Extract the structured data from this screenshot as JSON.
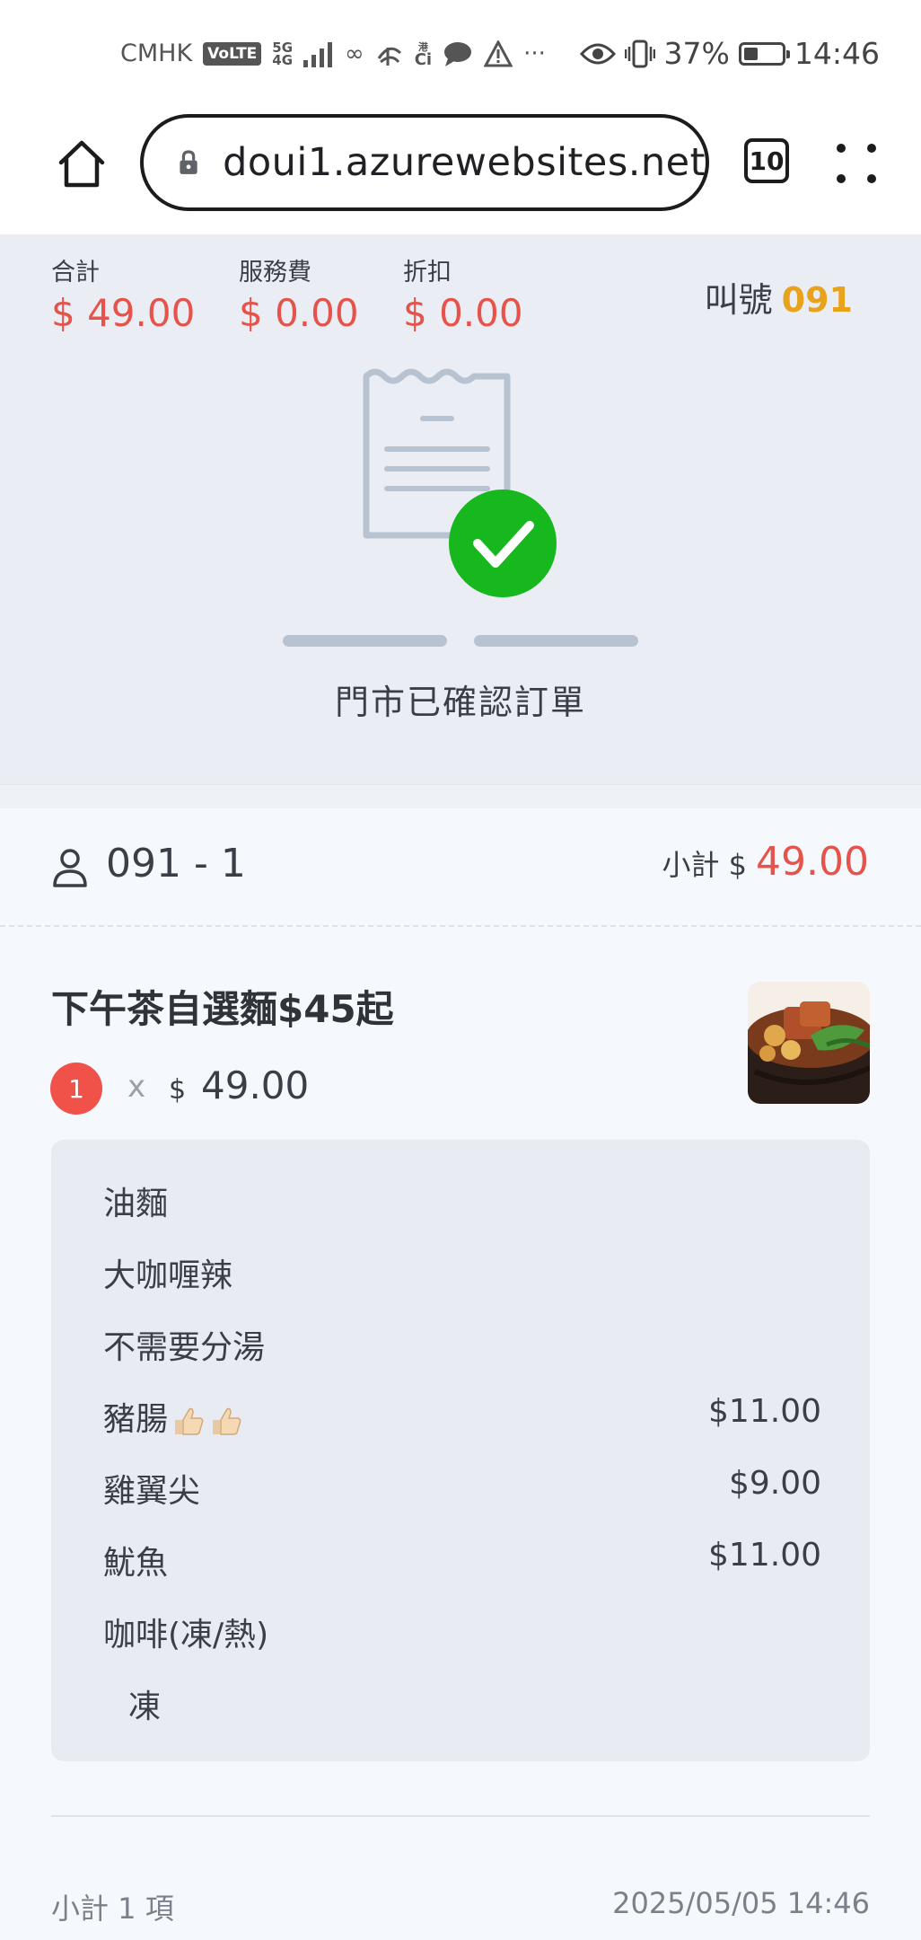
{
  "status_bar": {
    "carrier": "CMHK",
    "volte": "VoLTE",
    "network_top": "5G",
    "network_bottom": "4G",
    "battery_percent": "37%",
    "battery_level": 0.37,
    "time": "14:46",
    "icons": [
      "signal-icon",
      "infinity-icon",
      "rthk-icon",
      "ci-icon",
      "chat-bubble-icon",
      "warning-icon",
      "more-icon",
      "eye-icon",
      "vibrate-icon",
      "battery-icon"
    ]
  },
  "browser": {
    "url": "doui1.azurewebsites.net",
    "tab_count": "10",
    "icons": [
      "home-icon",
      "lock-icon",
      "tabs-icon",
      "menu-dots-icon"
    ]
  },
  "summary": {
    "total_label": "合計",
    "total_value": "$ 49.00",
    "service_label": "服務費",
    "service_value": "$ 0.00",
    "discount_label": "折扣",
    "discount_value": "$ 0.00",
    "call_label": "叫號",
    "call_number": "091",
    "status_text": "門市已確認訂單",
    "accent_red": "#e5534b",
    "accent_orange": "#e8a21b",
    "success_green": "#16b81e"
  },
  "order": {
    "order_no": "091 - 1",
    "subtotal_label": "小計 $",
    "subtotal_value": "49.00",
    "item": {
      "title": "下午茶自選麵$45起",
      "quantity": "1",
      "x": "x",
      "currency": "$",
      "price": "49.00"
    },
    "options": [
      {
        "name": "油麵",
        "price": ""
      },
      {
        "name": "大咖喱辣",
        "price": ""
      },
      {
        "name": "不需要分湯",
        "price": ""
      },
      {
        "name": "豬腸",
        "price": "$11.00"
      },
      {
        "name": "雞翼尖",
        "price": "$9.00"
      },
      {
        "name": "魷魚",
        "price": "$11.00"
      },
      {
        "name": "咖啡(凍/熱)",
        "price": ""
      },
      {
        "name": "凍",
        "price": ""
      }
    ],
    "footer_count": "小計 1 項",
    "footer_date": "2025/05/05 14:46"
  }
}
